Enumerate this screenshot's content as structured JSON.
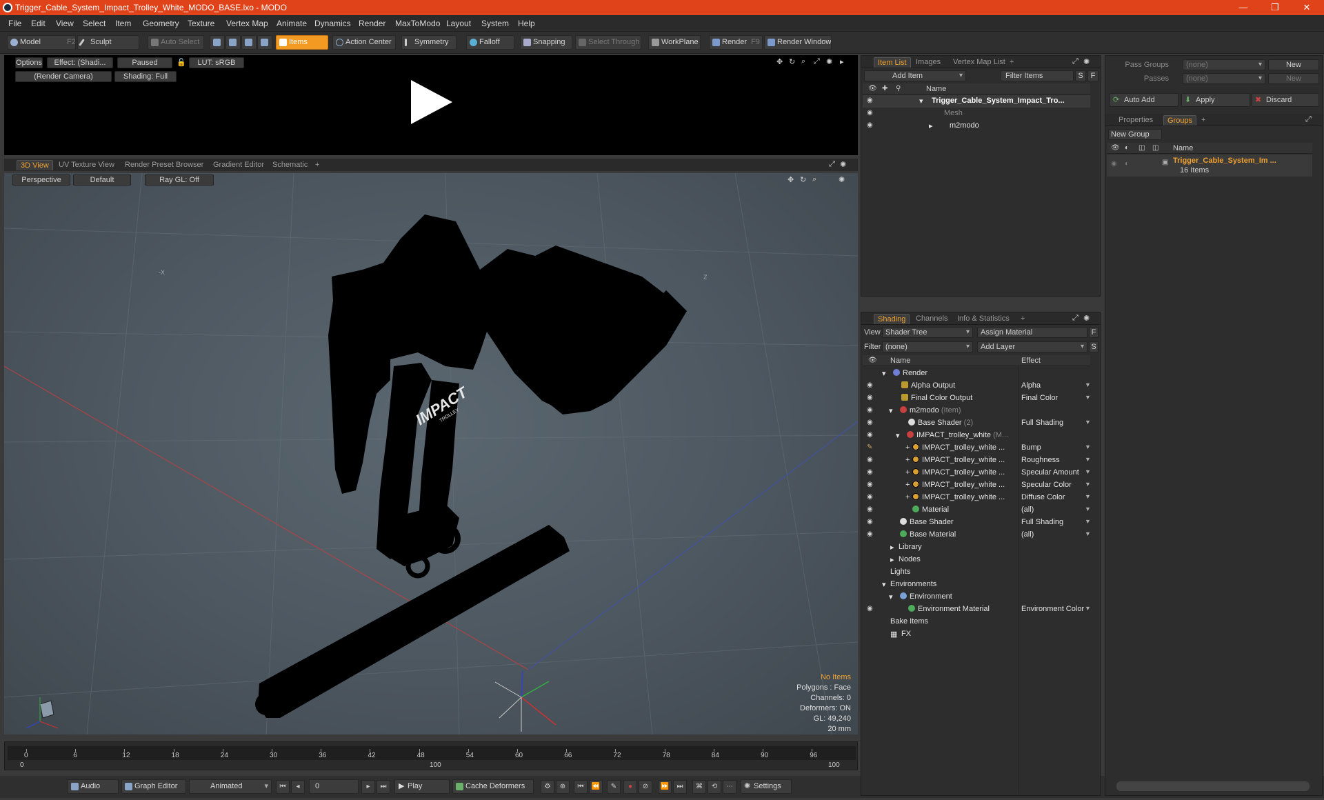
{
  "window": {
    "title": "Trigger_Cable_System_Impact_Trolley_White_MODO_BASE.lxo - MODO",
    "minimize": "—",
    "maximize": "❐",
    "close": "✕"
  },
  "menu": [
    "File",
    "Edit",
    "View",
    "Select",
    "Item",
    "Geometry",
    "Texture",
    "Vertex Map",
    "Animate",
    "Dynamics",
    "Render",
    "MaxToModo",
    "Layout",
    "System",
    "Help"
  ],
  "toolbar": {
    "model": "Model",
    "model_key": "F2",
    "sculpt": "Sculpt",
    "auto_select": "Auto Select",
    "items": "Items",
    "action_center": "Action Center",
    "symmetry": "Symmetry",
    "falloff": "Falloff",
    "snapping": "Snapping",
    "select_through": "Select Through",
    "workplane": "WorkPlane",
    "render": "Render",
    "render_key": "F9",
    "render_window": "Render Window"
  },
  "preview": {
    "options": "Options",
    "effect": "Effect: (Shadi...",
    "paused": "Paused",
    "lut": "LUT: sRGB",
    "camera": "(Render Camera)",
    "shading": "Shading: Full"
  },
  "view_tabs": [
    "3D View",
    "UV Texture View",
    "Render Preset Browser",
    "Gradient Editor",
    "Schematic"
  ],
  "viewport": {
    "perspective": "Perspective",
    "default": "Default",
    "raygl": "Ray GL: Off",
    "logo_text": "IMPACT",
    "logo_sub": "TROLLEY",
    "axis_x_label": "-X",
    "axis_z_label": "Z",
    "stats": {
      "no_items": "No Items",
      "polygons": "Polygons : Face",
      "channels": "Channels: 0",
      "deformers": "Deformers: ON",
      "gl": "GL: 49,240",
      "scale": "20 mm"
    }
  },
  "timeline": {
    "ticks": [
      "0",
      "6",
      "12",
      "18",
      "24",
      "30",
      "36",
      "42",
      "48",
      "54",
      "60",
      "66",
      "72",
      "78",
      "84",
      "90",
      "96"
    ],
    "range_start": "0",
    "range_mid": "100",
    "range_end": "100"
  },
  "bottombar": {
    "audio": "Audio",
    "graph_editor": "Graph Editor",
    "animated": "Animated",
    "frame": "0",
    "play": "Play",
    "cache_deformers": "Cache Deformers",
    "settings": "Settings"
  },
  "item_list": {
    "tabs": [
      "Item List",
      "Images",
      "Vertex Map List"
    ],
    "add_item": "Add Item",
    "filter_items": "Filter Items",
    "s_btn": "S",
    "f_btn": "F",
    "col_name": "Name",
    "rows": [
      {
        "name": "Trigger_Cable_System_Impact_Tro...",
        "bold": true
      },
      {
        "name": "Mesh",
        "dim": true
      },
      {
        "name": "m2modo"
      }
    ]
  },
  "shading": {
    "tabs": [
      "Shading",
      "Channels",
      "Info & Statistics"
    ],
    "view_label": "View",
    "view_value": "Shader Tree",
    "assign_material": "Assign Material",
    "f_btn": "F",
    "filter_label": "Filter",
    "filter_value": "(none)",
    "add_layer": "Add Layer",
    "s_btn": "S",
    "col_name": "Name",
    "col_effect": "Effect",
    "rows": [
      {
        "name": "Render",
        "effect": ""
      },
      {
        "name": "Alpha Output",
        "effect": "Alpha"
      },
      {
        "name": "Final Color Output",
        "effect": "Final Color"
      },
      {
        "name": "m2modo",
        "suffix": "(Item)",
        "effect": ""
      },
      {
        "name": "Base Shader",
        "suffix": "(2)",
        "effect": "Full Shading"
      },
      {
        "name": "IMPACT_trolley_white",
        "suffix": "(M...",
        "effect": ""
      },
      {
        "name": "IMPACT_trolley_white ...",
        "effect": "Bump"
      },
      {
        "name": "IMPACT_trolley_white ...",
        "effect": "Roughness"
      },
      {
        "name": "IMPACT_trolley_white ...",
        "effect": "Specular Amount"
      },
      {
        "name": "IMPACT_trolley_white ...",
        "effect": "Specular Color"
      },
      {
        "name": "IMPACT_trolley_white ...",
        "effect": "Diffuse Color"
      },
      {
        "name": "Material",
        "effect": "(all)"
      },
      {
        "name": "Base Shader",
        "effect": "Full Shading"
      },
      {
        "name": "Base Material",
        "effect": "(all)"
      },
      {
        "name": "Library",
        "effect": ""
      },
      {
        "name": "Nodes",
        "effect": ""
      },
      {
        "name": "Lights",
        "effect": ""
      },
      {
        "name": "Environments",
        "effect": ""
      },
      {
        "name": "Environment",
        "effect": ""
      },
      {
        "name": "Environment Material",
        "effect": "Environment Color"
      },
      {
        "name": "Bake Items",
        "effect": ""
      },
      {
        "name": "FX",
        "effect": ""
      }
    ]
  },
  "groups": {
    "pass_groups_label": "Pass Groups",
    "pass_groups_value": "(none)",
    "passes_label": "Passes",
    "passes_value": "(none)",
    "new1": "New",
    "new2": "New",
    "auto_add": "Auto Add",
    "apply": "Apply",
    "discard": "Discard",
    "tabs": [
      "Properties",
      "Groups"
    ],
    "new_group": "New Group",
    "col_name": "Name",
    "group_name": "Trigger_Cable_System_Im ...",
    "group_count": "16 Items"
  },
  "colors": {
    "titlebar": "#e0431a",
    "accent": "#f29a21"
  }
}
